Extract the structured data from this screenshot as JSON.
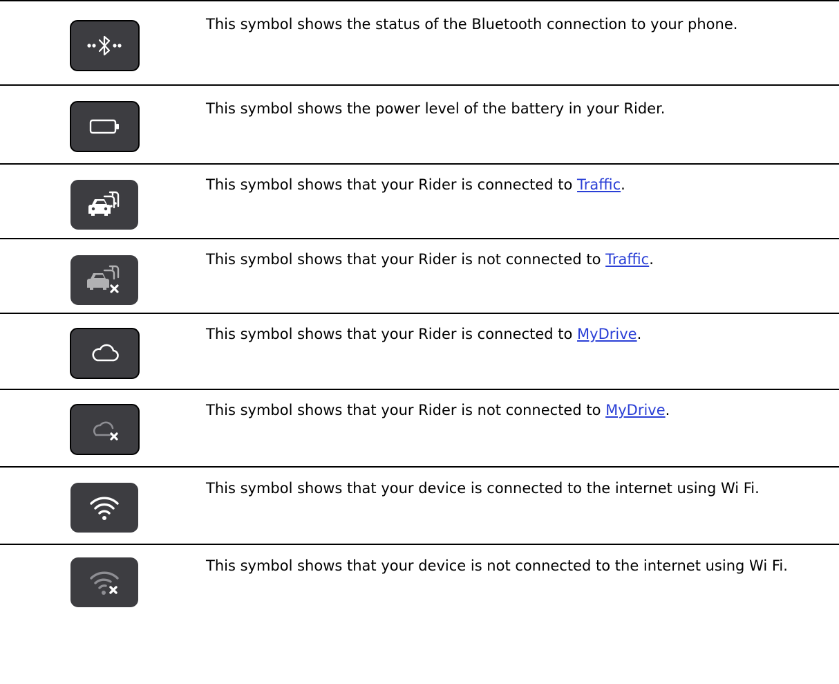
{
  "rows": [
    {
      "icon": "bluetooth-icon",
      "text": "This symbol shows the status of the Bluetooth connection to your phone.",
      "link": "",
      "suffix": ""
    },
    {
      "icon": "battery-icon",
      "text": "This symbol shows the power level of the battery in your Rider.",
      "link": "",
      "suffix": ""
    },
    {
      "icon": "traffic-icon",
      "text": "This symbol shows that your Rider is connected to ",
      "link": "Traffic",
      "suffix": "."
    },
    {
      "icon": "traffic-disconnected-icon",
      "text": "This symbol shows that your Rider is not connected to ",
      "link": "Traffic",
      "suffix": "."
    },
    {
      "icon": "cloud-icon",
      "text": "This symbol shows that your Rider is connected to ",
      "link": "MyDrive",
      "suffix": "."
    },
    {
      "icon": "cloud-disconnected-icon",
      "text": "This symbol shows that your Rider is not connected to ",
      "link": "MyDrive",
      "suffix": "."
    },
    {
      "icon": "wifi-icon",
      "text": "This symbol shows that your device is connected to the internet using Wi Fi.",
      "link": "",
      "suffix": ""
    },
    {
      "icon": "wifi-disconnected-icon",
      "text": "This symbol shows that your device is not connected to the internet using Wi Fi.",
      "link": "",
      "suffix": ""
    }
  ],
  "colors": {
    "icon_background": "#3d3d41",
    "icon_foreground": "#ffffff",
    "icon_dimmed": "#8e8e93",
    "link": "#2a3fd6",
    "rule": "#000000"
  }
}
